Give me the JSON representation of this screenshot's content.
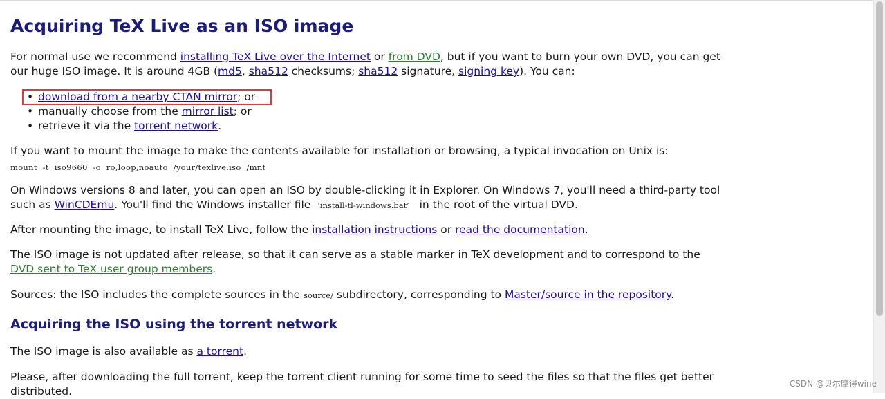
{
  "heading": "Acquiring TeX Live as an ISO image",
  "p1": {
    "t1": "For normal use we recommend ",
    "link_internet": "installing TeX Live over the Internet",
    "t2": " or ",
    "link_dvd": "from DVD",
    "t3": ", but if you want to burn your own DVD, you can get our huge ISO image. It is around 4GB (",
    "link_md5": "md5",
    "t4": ", ",
    "link_sha512": "sha512",
    "t5": " checksums; ",
    "link_sha512_sig": "sha512",
    "t6": " signature, ",
    "link_signing_key": "signing key",
    "t7": "). You can:"
  },
  "list": {
    "bullet": "•",
    "item1_link": "download from a nearby CTAN mirror",
    "item1_tail": "; or",
    "item2_head": "manually choose from the ",
    "item2_link": "mirror list",
    "item2_tail": "; or",
    "item3_head": "retrieve it via the ",
    "item3_link": "torrent network",
    "item3_tail": "."
  },
  "p2": "If you want to mount the image to make the contents available for installation or browsing, a typical invocation on Unix is:",
  "command": "mount  -t  iso9660  -o  ro,loop,noauto  /your/texlive.iso  /mnt",
  "p3": {
    "t1": "On Windows versions 8 and later, you can open an ISO by double-clicking it in Explorer. On Windows 7, you'll need a third-party tool such as ",
    "link_wincdemu": "WinCDEmu",
    "t2": ". You'll find the Windows installer file ",
    "file": "‘install-tl-windows.bat’",
    "t3": " in the root of the virtual DVD."
  },
  "p4": {
    "t1": "After mounting the image, to install TeX Live, follow the ",
    "link_install": "installation instructions",
    "t2": " or ",
    "link_docs": "read the documentation",
    "t3": "."
  },
  "p5": {
    "t1": "The ISO image is not updated after release, so that it can serve as a stable marker in TeX development and to correspond to the ",
    "link_dvd_members": "DVD sent to TeX user group members",
    "t2": "."
  },
  "p6": {
    "t1": "Sources: the ISO includes the complete sources in the ",
    "code": "source/",
    "t2": " subdirectory, corresponding to ",
    "link_repo": "Master/source in the repository",
    "t3": "."
  },
  "heading2": "Acquiring the ISO using the torrent network",
  "p7": {
    "t1": "The ISO image is also available as ",
    "link_torrent": "a torrent",
    "t2": "."
  },
  "p8": "Please, after downloading the full torrent, keep the torrent client running for some time to seed the files so that the files get better distributed.",
  "watermark": "CSDN @贝尔摩得wine",
  "colors": {
    "heading": "#1c1c7a",
    "link": "#1a0dab",
    "link_green": "#2e7d32",
    "highlight_box": "#e53935"
  }
}
